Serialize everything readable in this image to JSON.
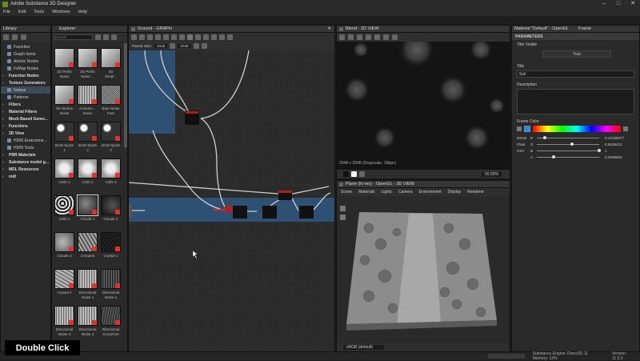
{
  "app": {
    "title": "Adobe Substance 3D Designer"
  },
  "menu": [
    "File",
    "Edit",
    "Tools",
    "Windows",
    "Help"
  ],
  "library": {
    "panel_title": "Library",
    "tree": [
      {
        "label": "Favorites",
        "level": 1
      },
      {
        "label": "Graph Items",
        "level": 1
      },
      {
        "label": "Atomic Nodes",
        "level": 1
      },
      {
        "label": "FxMap Nodes",
        "level": 1
      },
      {
        "label": "Function Nodes",
        "level": 0
      },
      {
        "label": "Texture Generators",
        "level": 0
      },
      {
        "label": "Noises",
        "level": 1,
        "selected": true
      },
      {
        "label": "Patterns",
        "level": 1
      },
      {
        "label": "Filters",
        "level": 0
      },
      {
        "label": "Material Filters",
        "level": 0
      },
      {
        "label": "Mesh Based Gener...",
        "level": 0
      },
      {
        "label": "Functions",
        "level": 0
      },
      {
        "label": "3D View",
        "level": 0
      },
      {
        "label": "HDRI Environme...",
        "level": 1
      },
      {
        "label": "HDRI Tools",
        "level": 1
      },
      {
        "label": "PBR Materials",
        "level": 0
      },
      {
        "label": "Substance model g...",
        "level": 0
      },
      {
        "label": "MDL Resources",
        "level": 0
      },
      {
        "label": "mdl",
        "level": 0
      }
    ],
    "explorer_tab": "Explorer",
    "search_placeholder": "Search",
    "thumbs": [
      {
        "label": "3D Perlin\nNoise",
        "style": "cube"
      },
      {
        "label": "3D Perlin\nNoise ...",
        "style": "cube"
      },
      {
        "label": "3D\nSimpl...",
        "style": "cube"
      },
      {
        "label": "3D Worley\nNoise",
        "style": "cube"
      },
      {
        "label": "Anisotro...\nNoise",
        "style": "lines"
      },
      {
        "label": "Blue Noise\nFast",
        "style": "fine"
      },
      {
        "label": "BnW Spots\n1",
        "style": "spots"
      },
      {
        "label": "BnW Spots\n2",
        "style": "spots"
      },
      {
        "label": "BnW Spots\n3",
        "style": "spots"
      },
      {
        "label": "Cells 1",
        "style": "cells-light"
      },
      {
        "label": "Cells 2",
        "style": "cells-light"
      },
      {
        "label": "Cells 3",
        "style": "cells-light"
      },
      {
        "label": "Cells 4",
        "style": "cells-dark"
      },
      {
        "label": "Clouds 1",
        "style": "clouds",
        "selected": true
      },
      {
        "label": "Clouds 2",
        "style": "clouds-dark"
      },
      {
        "label": "Clouds 3",
        "style": "clouds-light"
      },
      {
        "label": "Creased",
        "style": "creased"
      },
      {
        "label": "Crystal 1",
        "style": "crystal"
      },
      {
        "label": "Crystal 2",
        "style": "wave"
      },
      {
        "label": "Directional\nNoise 1",
        "style": "lines"
      },
      {
        "label": "Directional\nNoise 2",
        "style": "lines-dark"
      },
      {
        "label": "Directional\nNoise 3",
        "style": "lines"
      },
      {
        "label": "Directional\nNoise 4",
        "style": "lines"
      },
      {
        "label": "Directional\nScratches",
        "style": "scratch"
      }
    ]
  },
  "graph": {
    "tab_title": "Ground - GRAPH",
    "parent_size_label": "Parent Size:",
    "parent_size_value": "2048",
    "size_value": "2048"
  },
  "view2d": {
    "tab_title": "Blend - 2D VIEW",
    "info": "2048 x 2048 (Grayscale, 16bpc)",
    "zoom": "55.55%"
  },
  "view3d": {
    "tab_title": "Plane (hi-res) - OpenGL - 3D VIEW",
    "menu": [
      "Scene",
      "Materials",
      "Lights",
      "Camera",
      "Environment",
      "Display",
      "Renderer"
    ],
    "colorspace": "sRGB (default)"
  },
  "properties": {
    "tab_title": "Material \"Default\" - OpenGL",
    "frame_tab": "Frame",
    "section": "PARAMETERS",
    "title_visible_label": "Title Visible",
    "title_visible_value": "True",
    "title_label": "Title",
    "title_value": "Soil",
    "description_label": "Description",
    "frame_color_label": "Frame Color",
    "modes": [
      "sRGB",
      "Float",
      "HSV"
    ],
    "channels": [
      {
        "name": "R",
        "value": "0.1019607†",
        "fraction": 0.1
      },
      {
        "name": "G",
        "value": "0.5529412",
        "fraction": 0.55
      },
      {
        "name": "B",
        "value": "1",
        "fraction": 1.0
      },
      {
        "name": "A",
        "value": "0.2509804",
        "fraction": 0.25
      }
    ],
    "accent": "#1a8dff"
  },
  "status": {
    "engine": "Substance Engine: Direct3D 11  Memory: 13%",
    "version": "Version: 11.3.3"
  },
  "overlay": {
    "action": "Double Click"
  }
}
